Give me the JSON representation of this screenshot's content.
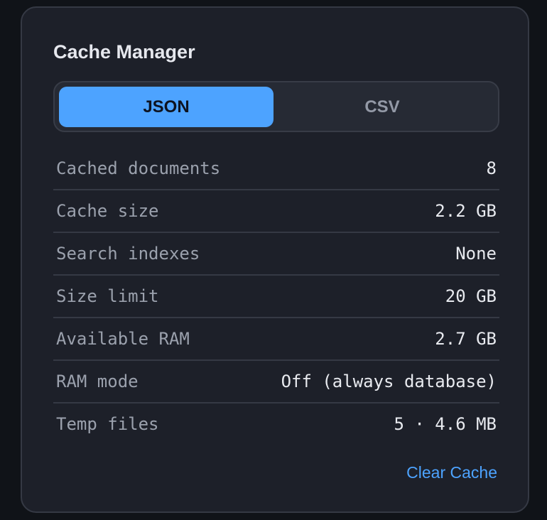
{
  "panel": {
    "title": "Cache Manager"
  },
  "format_toggle": {
    "options": [
      "JSON",
      "CSV"
    ],
    "selected": "JSON"
  },
  "stats": [
    {
      "label": "Cached documents",
      "value": "8"
    },
    {
      "label": "Cache size",
      "value": "2.2 GB"
    },
    {
      "label": "Search indexes",
      "value": "None"
    },
    {
      "label": "Size limit",
      "value": "20 GB"
    },
    {
      "label": "Available RAM",
      "value": "2.7 GB"
    },
    {
      "label": "RAM mode",
      "value": "Off (always database)"
    },
    {
      "label": "Temp files",
      "value": "5 · 4.6 MB"
    }
  ],
  "actions": {
    "clear_label": "Clear Cache"
  },
  "colors": {
    "accent": "#4da3ff",
    "panel_bg": "#1d2029",
    "page_bg": "#101318"
  }
}
